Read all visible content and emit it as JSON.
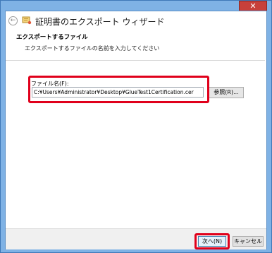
{
  "window": {
    "title": "証明書のエクスポート ウィザード",
    "close_label": "✕"
  },
  "header": {
    "title": "エクスポートするファイル",
    "subtitle": "エクスポートするファイルの名前を入力してください"
  },
  "form": {
    "filename_label": "ファイル名(F):",
    "filename_value": "C:¥Users¥Administrator¥Desktop¥GlueTest1Certification.cer",
    "browse_label": "参照(R)..."
  },
  "footer": {
    "next_label": "次へ(N)",
    "cancel_label": "キャンセル"
  },
  "colors": {
    "highlight": "#e0001b",
    "window_frame": "#7fb2e5",
    "close_button": "#c7403a"
  }
}
